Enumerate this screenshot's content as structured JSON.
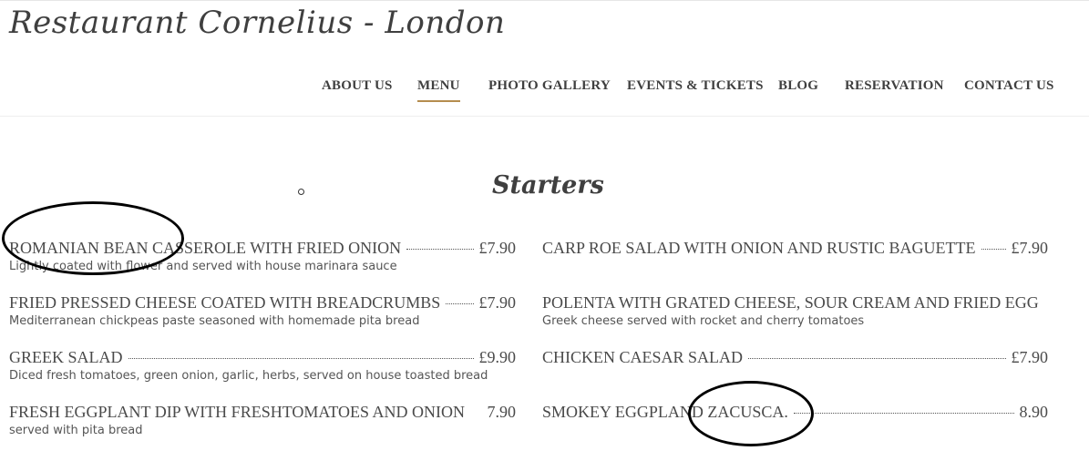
{
  "site": {
    "title": "Restaurant Cornelius - London"
  },
  "nav": {
    "items": [
      {
        "label": "ABOUT US"
      },
      {
        "label": "MENU"
      },
      {
        "label": "PHOTO GALLERY"
      },
      {
        "label": "EVENTS & TICKETS"
      },
      {
        "label": "BLOG"
      },
      {
        "label": "RESERVATION"
      },
      {
        "label": "CONTACT US"
      }
    ],
    "active": "MENU"
  },
  "section": {
    "title": "Starters"
  },
  "menu": {
    "left": [
      {
        "name": "ROMANIAN BEAN CASSEROLE WITH FRIED ONION",
        "price": "£7.90",
        "desc": "Lightly coated with flower and served with house marinara sauce"
      },
      {
        "name": "FRIED PRESSED CHEESE COATED WITH BREADCRUMBS",
        "price": "£7.90",
        "desc": "Mediterranean chickpeas paste seasoned with homemade pita bread"
      },
      {
        "name": "GREEK SALAD",
        "price": "£9.90",
        "desc": "Diced fresh tomatoes, green onion, garlic, herbs, served on house toasted bread"
      },
      {
        "name": "FRESH EGGPLANT DIP WITH FRESHTOMATOES AND ONION",
        "price": "7.90",
        "desc": "served with pita bread"
      }
    ],
    "right": [
      {
        "name": "CARP ROE SALAD WITH ONION AND RUSTIC BAGUETTE",
        "price": "£7.90",
        "desc": ""
      },
      {
        "name": "POLENTA WITH GRATED CHEESE, SOUR CREAM AND FRIED EGG",
        "price": "",
        "desc": "Greek cheese served with rocket and cherry tomatoes"
      },
      {
        "name": "CHICKEN CAESAR SALAD",
        "price": "£7.90",
        "desc": ""
      },
      {
        "name": "SMOKEY EGGPLAND ZACUSCA.",
        "price": "8.90",
        "desc": ""
      }
    ]
  },
  "colors": {
    "accent": "#b58d4f",
    "text": "#4a4a4a",
    "annotation": "#000000"
  }
}
